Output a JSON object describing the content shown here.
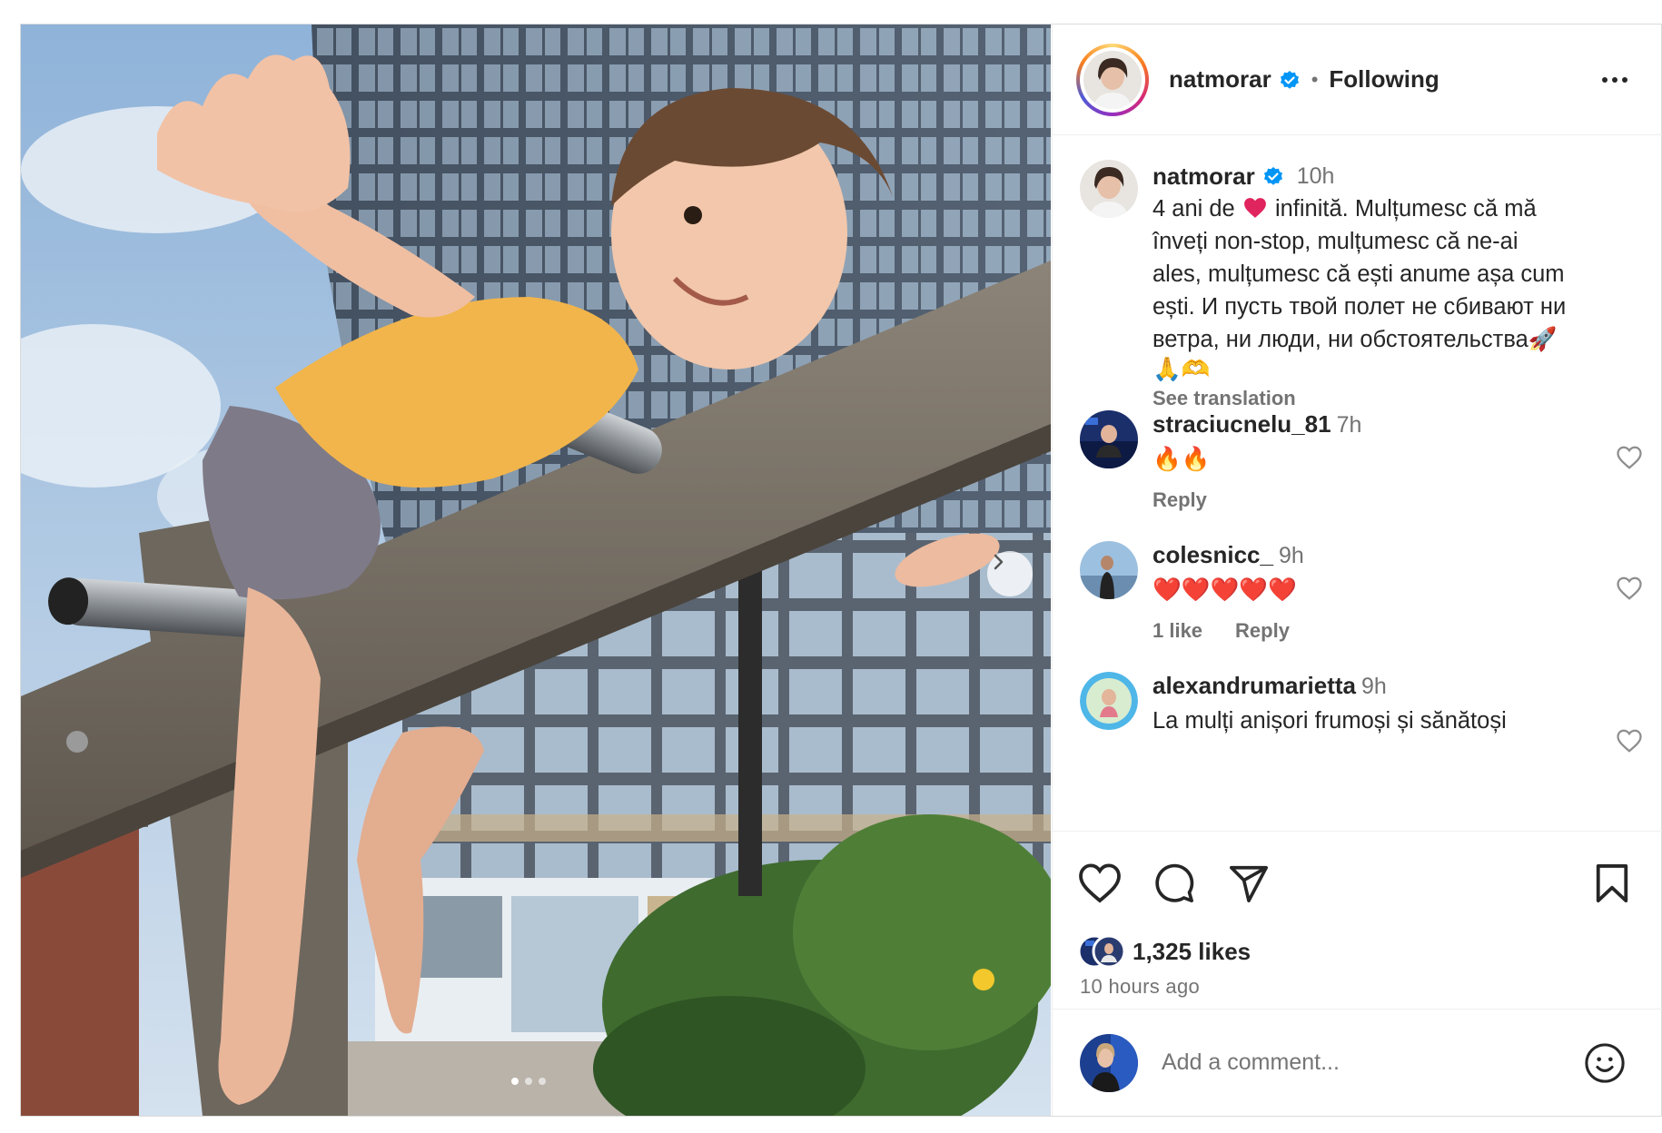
{
  "post": {
    "author": "natmorar",
    "separator": "•",
    "follow_state": "Following",
    "more_label": "More options"
  },
  "caption": {
    "username": "natmorar",
    "time": "10h",
    "line1_a": "4 ani de",
    "line1_b": "infinită. Mulțumesc că mă",
    "line2": "înveți non-stop, mulțumesc că ne-ai",
    "line3": "ales, mulțumesc că ești anume așa cum",
    "line4": "ești. И пусть твой полет не сбивают ни",
    "line5": "ветра, ни люди, ни обстоятельства🚀",
    "line6": "🙏🫶",
    "see_translation": "See translation"
  },
  "comments": [
    {
      "username": "straciucnelu_81",
      "time": "7h",
      "text": "🔥🔥",
      "likes": "",
      "reply": "Reply"
    },
    {
      "username": "colesnicc_",
      "time": "9h",
      "text": "❤️❤️❤️❤️❤️",
      "likes": "1 like",
      "reply": "Reply"
    },
    {
      "username": "alexandrumarietta",
      "time": "9h",
      "text": "La mulți anișori frumoși și sănătoși",
      "likes": "",
      "reply": ""
    }
  ],
  "stats": {
    "likes": "1,325 likes",
    "posted": "10 hours ago"
  },
  "composer": {
    "placeholder": "Add a comment..."
  },
  "carousel": {
    "slide_count": 3,
    "active_slide": 1
  },
  "colors": {
    "verified": "#0095f6",
    "text_primary": "#262626",
    "text_secondary": "#737373",
    "heart": "#ff3040"
  },
  "icons": {
    "like": "heart-outline-icon",
    "comment": "speech-bubble-icon",
    "share": "paper-plane-icon",
    "save": "bookmark-icon",
    "emoji": "smiley-icon",
    "next": "chevron-right-icon",
    "verified": "verified-badge-icon"
  }
}
